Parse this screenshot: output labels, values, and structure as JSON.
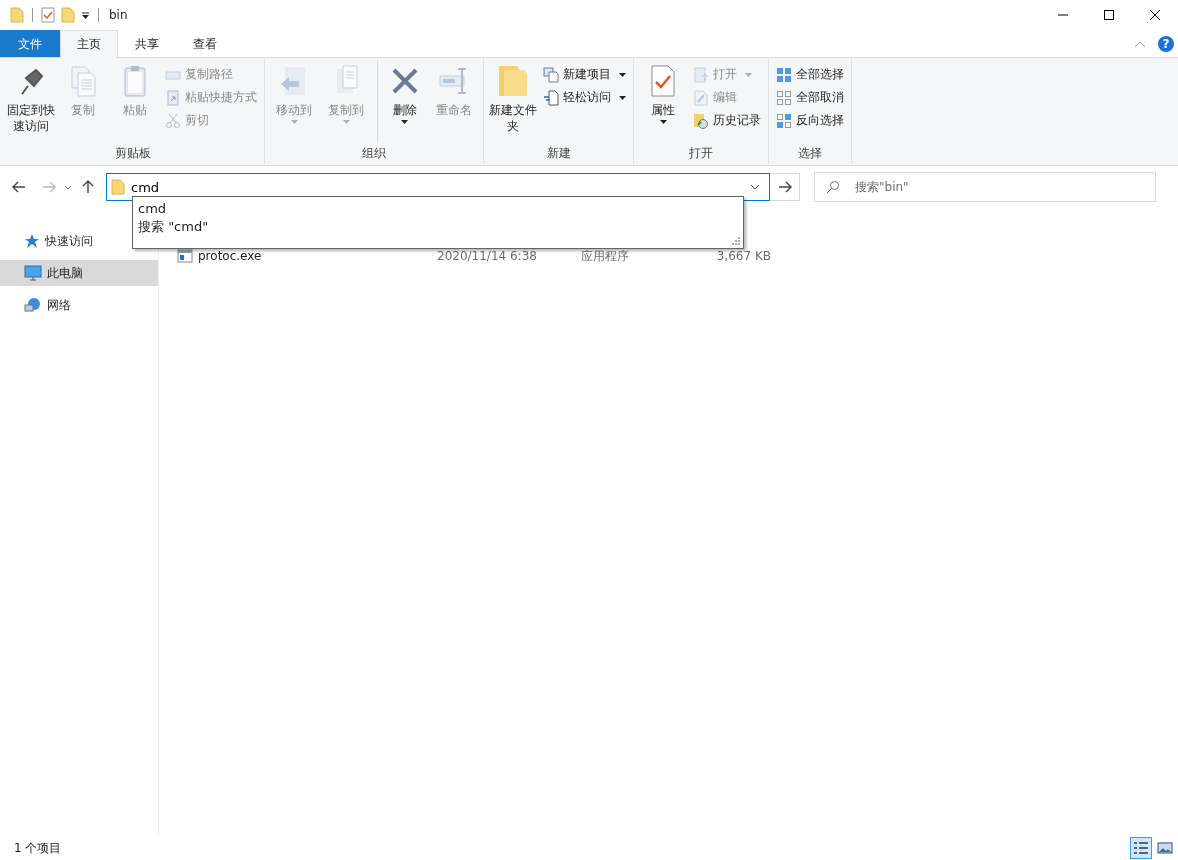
{
  "title_bar": {
    "title": "bin"
  },
  "ribbon_tabs": [
    {
      "label": "文件",
      "kind": "file",
      "selected": false
    },
    {
      "label": "主页",
      "kind": "tab",
      "selected": true
    },
    {
      "label": "共享",
      "kind": "tab",
      "selected": false
    },
    {
      "label": "查看",
      "kind": "tab",
      "selected": false
    }
  ],
  "help_button": {
    "label": "?"
  },
  "ribbon_groups": [
    {
      "label": "剪贴板",
      "buttons": [
        {
          "label": "固定到快速访问",
          "kind": "large",
          "disabled": false,
          "dropdown": false
        },
        {
          "label": "复制",
          "kind": "large",
          "disabled": true,
          "dropdown": false
        },
        {
          "label": "粘贴",
          "kind": "large",
          "disabled": true,
          "dropdown": false
        },
        {
          "label": "复制路径",
          "kind": "small",
          "disabled": true,
          "dropdown": false
        },
        {
          "label": "粘贴快捷方式",
          "kind": "small",
          "disabled": true,
          "dropdown": false
        },
        {
          "label": "剪切",
          "kind": "small",
          "disabled": true,
          "dropdown": false
        }
      ]
    },
    {
      "label": "组织",
      "buttons": [
        {
          "label": "移动到",
          "kind": "large",
          "disabled": true,
          "dropdown": true
        },
        {
          "label": "复制到",
          "kind": "large",
          "disabled": true,
          "dropdown": true
        },
        {
          "label": "删除",
          "kind": "large",
          "disabled": false,
          "dropdown": true
        },
        {
          "label": "重命名",
          "kind": "large",
          "disabled": true,
          "dropdown": false
        }
      ]
    },
    {
      "label": "新建",
      "buttons": [
        {
          "label": "新建文件夹",
          "kind": "large",
          "disabled": false,
          "dropdown": false
        },
        {
          "label": "新建项目",
          "kind": "small",
          "disabled": false,
          "dropdown": true
        },
        {
          "label": "轻松访问",
          "kind": "small",
          "disabled": false,
          "dropdown": true
        }
      ]
    },
    {
      "label": "打开",
      "buttons": [
        {
          "label": "属性",
          "kind": "large",
          "disabled": false,
          "dropdown": true
        },
        {
          "label": "打开",
          "kind": "small",
          "disabled": true,
          "dropdown": true
        },
        {
          "label": "编辑",
          "kind": "small",
          "disabled": true,
          "dropdown": false
        },
        {
          "label": "历史记录",
          "kind": "small",
          "disabled": false,
          "dropdown": false
        }
      ]
    },
    {
      "label": "选择",
      "buttons": [
        {
          "label": "全部选择",
          "kind": "small",
          "disabled": false,
          "dropdown": false
        },
        {
          "label": "全部取消",
          "kind": "small",
          "disabled": false,
          "dropdown": false
        },
        {
          "label": "反向选择",
          "kind": "small",
          "disabled": false,
          "dropdown": false
        }
      ]
    }
  ],
  "address_bar": {
    "value": "cmd",
    "suggestions": [
      "cmd",
      "搜索 \"cmd\""
    ]
  },
  "search": {
    "placeholder": "搜索\"bin\""
  },
  "nav_pane": [
    {
      "label": "快速访问",
      "selected": false
    },
    {
      "label": "此电脑",
      "selected": true
    },
    {
      "label": "网络",
      "selected": false
    }
  ],
  "files": [
    {
      "name": "protoc.exe",
      "date": "2020/11/14 6:38",
      "type": "应用程序",
      "size": "3,667 KB"
    }
  ],
  "status_bar": {
    "count": "1 个项目",
    "views": [
      {
        "selected": true
      },
      {
        "selected": false
      }
    ]
  }
}
